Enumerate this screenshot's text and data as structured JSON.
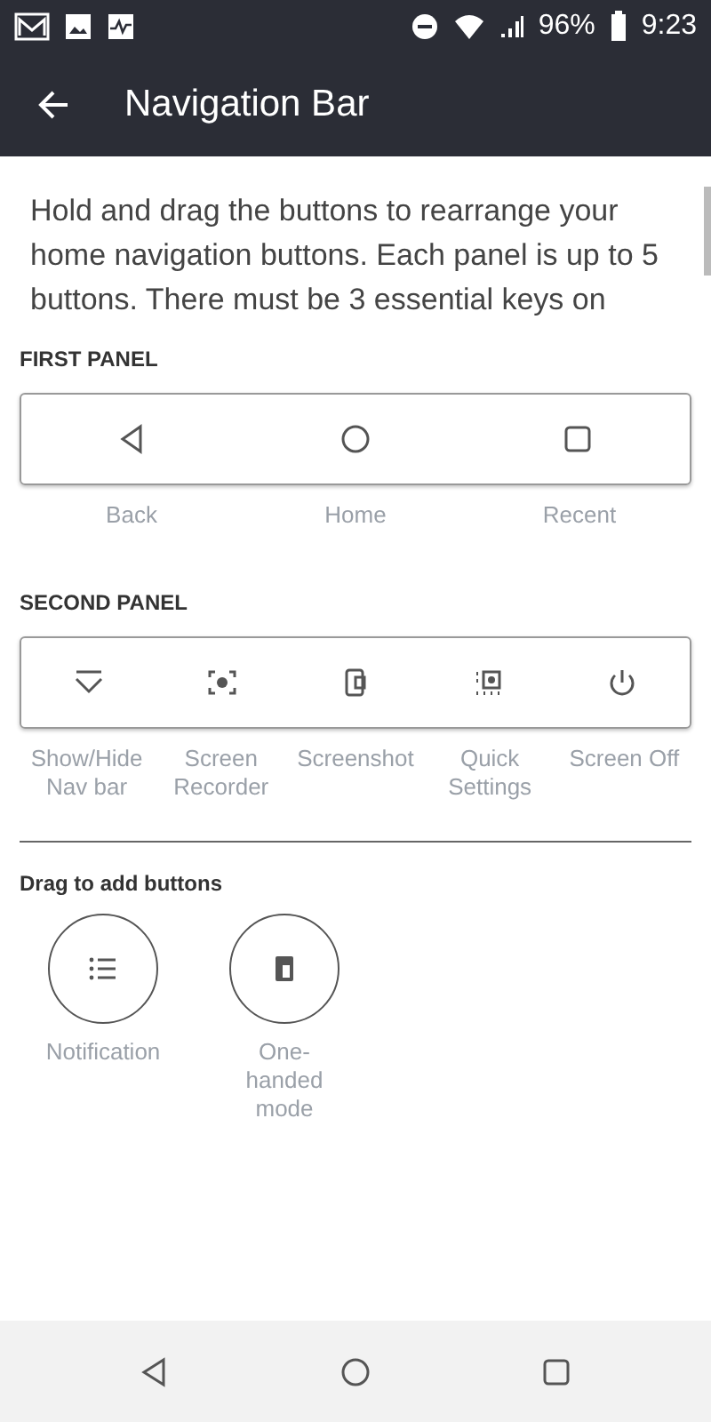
{
  "status_bar": {
    "battery": "96%",
    "time": "9:23"
  },
  "app_bar": {
    "title": "Navigation Bar"
  },
  "intro": "Hold and drag the buttons to rearrange your home navigation buttons. Each panel is up to 5 buttons. There must be 3 essential keys on",
  "panels": [
    {
      "title": "FIRST PANEL",
      "buttons": [
        {
          "kind": "back",
          "label": "Back"
        },
        {
          "kind": "home",
          "label": "Home"
        },
        {
          "kind": "recent",
          "label": "Recent"
        }
      ]
    },
    {
      "title": "SECOND PANEL",
      "buttons": [
        {
          "kind": "hide",
          "label": "Show/Hide Nav bar"
        },
        {
          "kind": "recorder",
          "label": "Screen Recorder"
        },
        {
          "kind": "screenshot",
          "label": "Screenshot"
        },
        {
          "kind": "quick",
          "label": "Quick Settings"
        },
        {
          "kind": "power",
          "label": "Screen Off"
        }
      ]
    }
  ],
  "extra": {
    "title": "Drag to add buttons",
    "buttons": [
      {
        "kind": "notification",
        "label": "Notification"
      },
      {
        "kind": "onehand",
        "label": "One-handed mode"
      }
    ]
  }
}
